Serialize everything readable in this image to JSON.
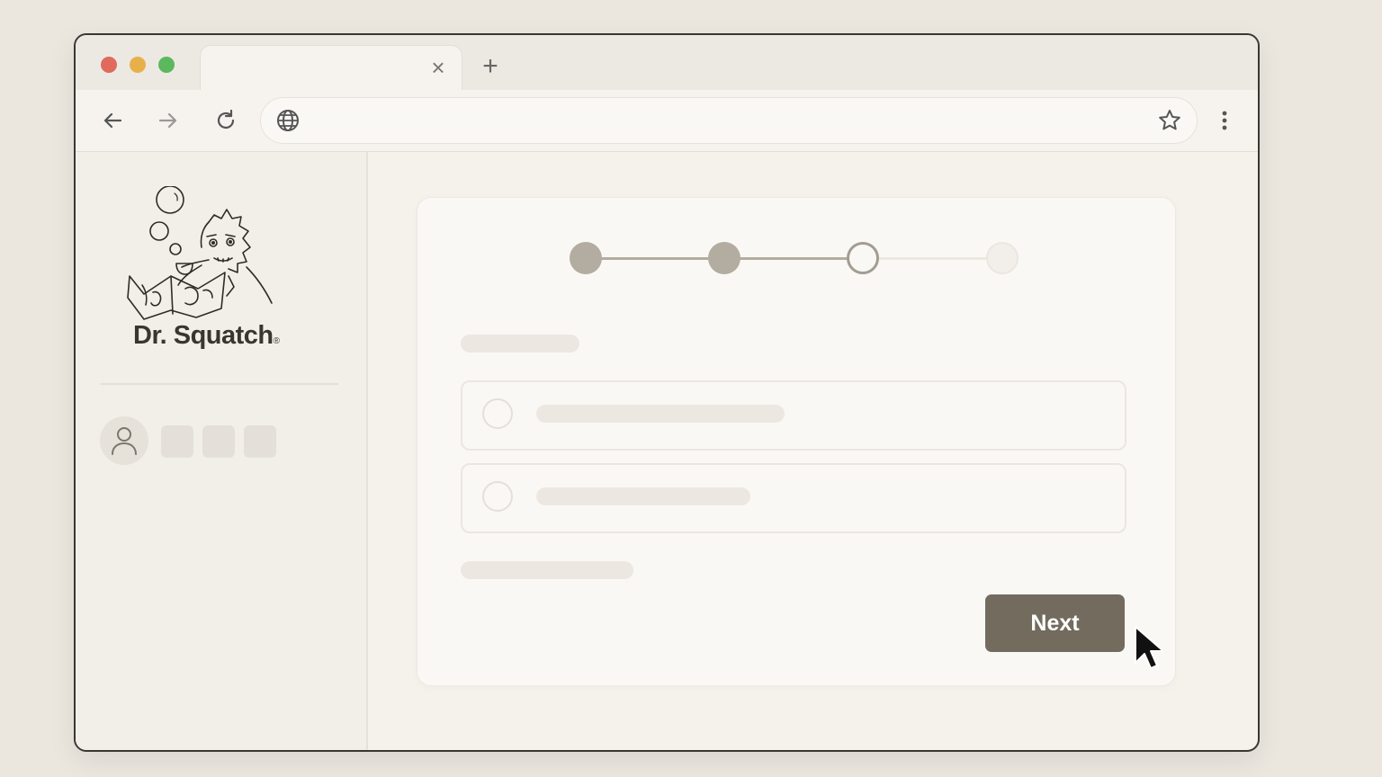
{
  "window": {
    "tab_close_icon": "close-icon",
    "new_tab_icon": "plus-icon",
    "traffic_lights": {
      "close": "#e06a5c",
      "minimize": "#e8b04a",
      "zoom": "#5cb85c"
    }
  },
  "toolbar": {
    "back_icon": "arrow-left-icon",
    "forward_icon": "arrow-right-icon",
    "reload_icon": "reload-icon",
    "site_icon": "globe-icon",
    "bookmark_icon": "star-icon",
    "menu_icon": "kebab-menu-icon",
    "address": ""
  },
  "sidebar": {
    "logo_text": "Dr. Squatch",
    "logo_mark": "®",
    "avatar_icon": "user-icon"
  },
  "form": {
    "steps_total": 4,
    "steps_completed": 2,
    "current_step": 3,
    "options": [
      {
        "selected": false
      },
      {
        "selected": false
      }
    ],
    "next_label": "Next"
  },
  "colors": {
    "accent": "#736b5e",
    "completed_step": "#b3aca0",
    "background": "#ebe7df"
  }
}
